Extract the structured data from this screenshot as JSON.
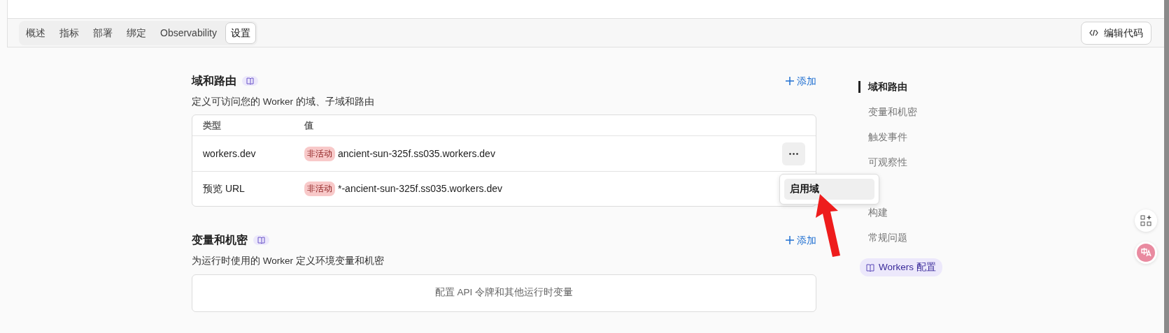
{
  "tabs": [
    {
      "label": "概述",
      "selected": false
    },
    {
      "label": "指标",
      "selected": false
    },
    {
      "label": "部署",
      "selected": false
    },
    {
      "label": "绑定",
      "selected": false
    },
    {
      "label": "Observability",
      "selected": false
    },
    {
      "label": "设置",
      "selected": true
    }
  ],
  "edit_code_button": "编辑代码",
  "domains_section": {
    "title": "域和路由",
    "add_label": "添加",
    "description": "定义可访问您的 Worker 的域、子域和路由",
    "columns": [
      "类型",
      "值"
    ],
    "rows": [
      {
        "type": "workers.dev",
        "status": "非活动",
        "value": "ancient-sun-325f.ss035.workers.dev",
        "has_menu": true
      },
      {
        "type": "预览 URL",
        "status": "非活动",
        "value": "*-ancient-sun-325f.ss035.workers.dev"
      }
    ],
    "menu": {
      "items": [
        {
          "label": "启用域",
          "selected": true
        }
      ]
    }
  },
  "variables_section": {
    "title": "变量和机密",
    "add_label": "添加",
    "description": "为运行时使用的 Worker 定义环境变量和机密",
    "empty_text": "配置 API 令牌和其他运行时变量"
  },
  "toc": [
    {
      "label": "域和路由",
      "selected": true
    },
    {
      "label": "变量和机密",
      "selected": false
    },
    {
      "label": "触发事件",
      "selected": false
    },
    {
      "label": "可观察性",
      "selected": false
    },
    {
      "label": "构建",
      "selected": false
    },
    {
      "label": "常规问题",
      "selected": false
    }
  ],
  "toc_doc_link": "Workers 配置"
}
